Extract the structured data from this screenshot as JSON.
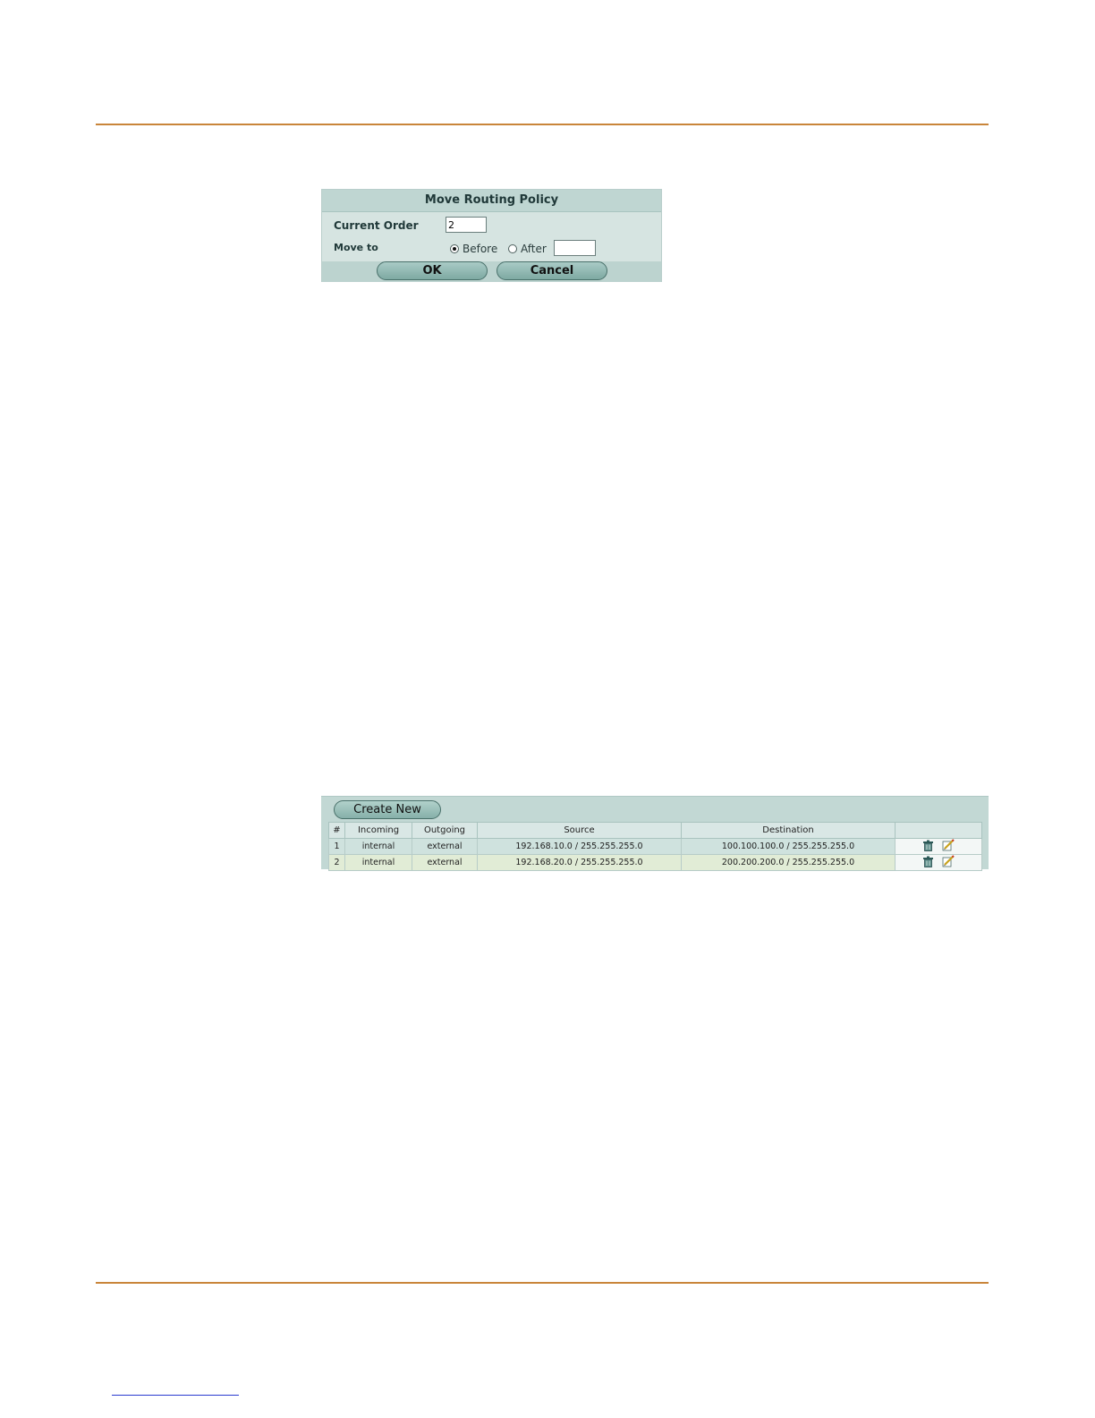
{
  "dialog": {
    "title": "Move Routing Policy",
    "current_order_label": "Current Order",
    "current_order_value": "2",
    "move_to_label": "Move to",
    "before_label": "Before",
    "after_label": "After",
    "before_selected": true,
    "after_value": "",
    "ok_label": "OK",
    "cancel_label": "Cancel"
  },
  "list": {
    "create_new_label": "Create New",
    "columns": [
      "#",
      "Incoming",
      "Outgoing",
      "Source",
      "Destination",
      ""
    ],
    "rows": [
      {
        "num": "1",
        "incoming": "internal",
        "outgoing": "external",
        "source": "192.168.10.0 / 255.255.255.0",
        "destination": "100.100.100.0 / 255.255.255.0"
      },
      {
        "num": "2",
        "incoming": "internal",
        "outgoing": "external",
        "source": "192.168.20.0 / 255.255.255.0",
        "destination": "200.200.200.0 / 255.255.255.0"
      }
    ],
    "icons": [
      "delete-icon",
      "edit-icon"
    ]
  },
  "colors": {
    "accent_rule": "#c9853a",
    "panel_bg": "#d6e4e1",
    "header_bg": "#bfd6d2"
  }
}
